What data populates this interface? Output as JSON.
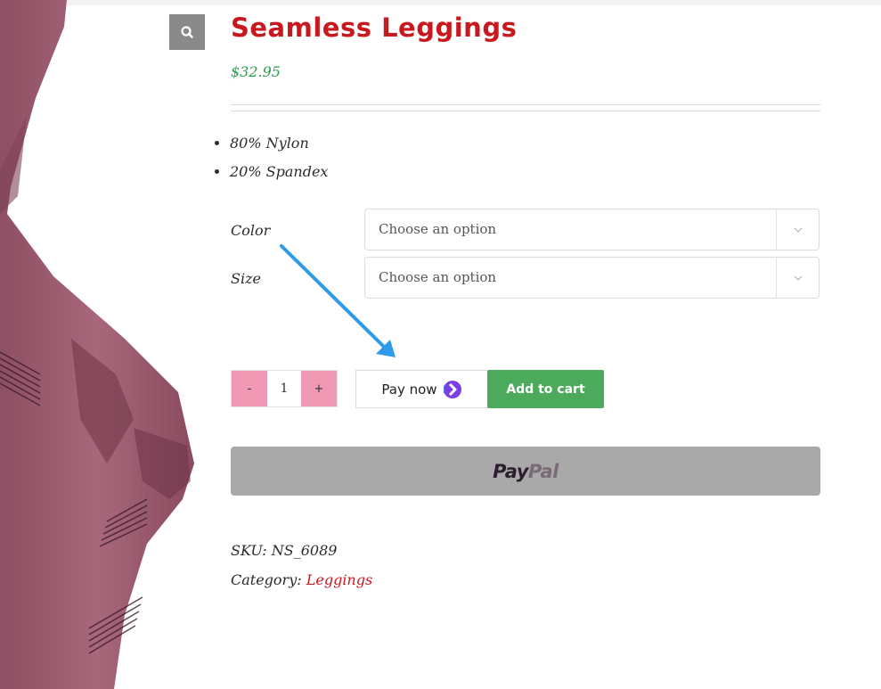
{
  "product": {
    "title": "Seamless Leggings",
    "price": "$32.95",
    "features": [
      "80% Nylon",
      "20% Spandex"
    ]
  },
  "variations": [
    {
      "label": "Color",
      "placeholder": "Choose an option"
    },
    {
      "label": "Size",
      "placeholder": "Choose an option"
    }
  ],
  "quantity": {
    "minus": "-",
    "value": "1",
    "plus": "+"
  },
  "buttons": {
    "pay_now": "Pay now",
    "add_to_cart": "Add to cart",
    "paypal_part1": "Pay",
    "paypal_part2": "Pal"
  },
  "meta": {
    "sku_label": "SKU:",
    "sku_value": "NS_6089",
    "category_label": "Category:",
    "category_value": "Leggings"
  },
  "icons": {
    "zoom": "search-icon",
    "select_arrow": "chevron-down-icon",
    "pay_now_logo": "chevron-circle-icon",
    "annotation": "arrow-annotation"
  },
  "colors": {
    "title": "#c8191f",
    "price": "#2e9a4b",
    "add_to_cart": "#4caa5c",
    "quantity_buttons": "#f098b4",
    "paypal_bg": "#a9a9a9",
    "annotation_arrow": "#2f9be8",
    "product_fabric": "#9a5a6e"
  }
}
